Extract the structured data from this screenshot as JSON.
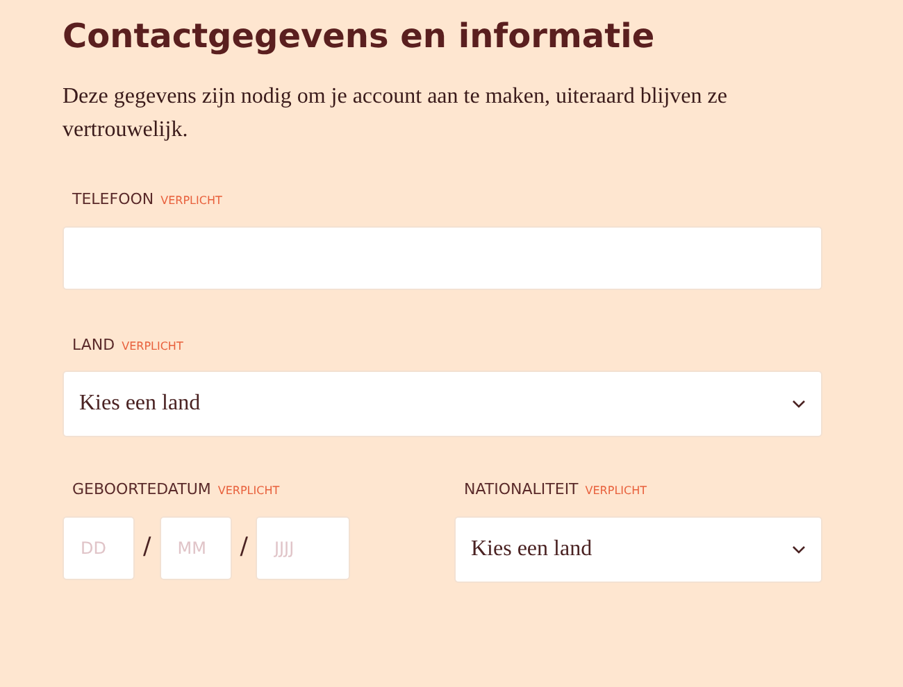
{
  "title": "Contactgegevens en informatie",
  "intro": "Deze gegevens zijn nodig om je account aan te maken, uiteraard blijven ze vertrouwelijk.",
  "phone": {
    "label": "TELEFOON",
    "required": "VERPLICHT"
  },
  "country": {
    "label": "LAND",
    "required": "VERPLICHT",
    "value": "Kies een land"
  },
  "birthdate": {
    "label": "GEBOORTEDATUM",
    "required": "VERPLICHT",
    "parts": [
      {
        "placeholder": "DD"
      },
      {
        "placeholder": "MM"
      },
      {
        "placeholder": "JJJJ"
      }
    ],
    "separators": [
      "/",
      "/"
    ]
  },
  "nationality": {
    "label": "NATIONALITEIT",
    "required": "VERPLICHT",
    "value": "Kies een land"
  }
}
